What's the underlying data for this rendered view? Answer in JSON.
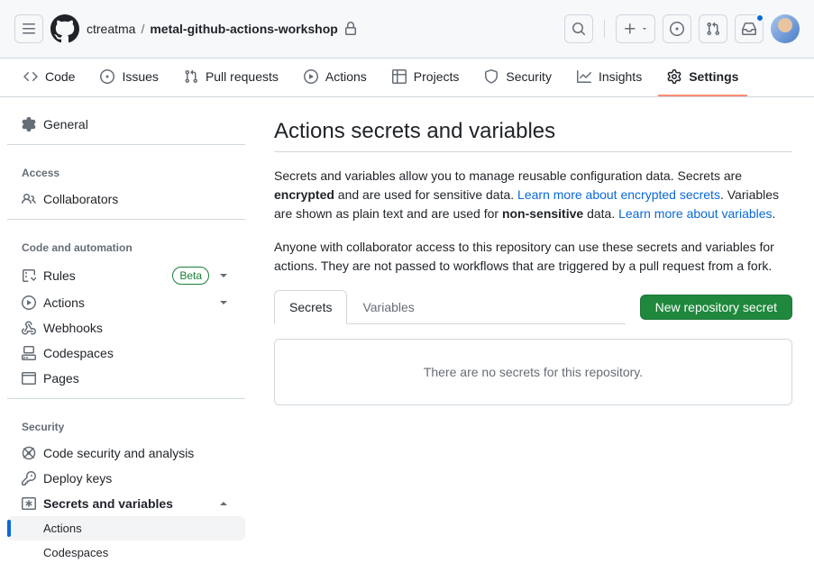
{
  "header": {
    "owner": "ctreatma",
    "repo": "metal-github-actions-workshop"
  },
  "repoNav": [
    {
      "label": "Code",
      "icon": "code-icon"
    },
    {
      "label": "Issues",
      "icon": "issue-icon"
    },
    {
      "label": "Pull requests",
      "icon": "pr-icon"
    },
    {
      "label": "Actions",
      "icon": "play-icon"
    },
    {
      "label": "Projects",
      "icon": "table-icon"
    },
    {
      "label": "Security",
      "icon": "shield-icon"
    },
    {
      "label": "Insights",
      "icon": "graph-icon"
    },
    {
      "label": "Settings",
      "icon": "gear-icon",
      "active": true
    }
  ],
  "sidebar": {
    "general": "General",
    "groups": [
      {
        "heading": "Access",
        "items": [
          {
            "label": "Collaborators",
            "icon": "people-icon"
          }
        ]
      },
      {
        "heading": "Code and automation",
        "items": [
          {
            "label": "Rules",
            "icon": "rules-icon",
            "badge": "Beta",
            "expandable": true
          },
          {
            "label": "Actions",
            "icon": "play-icon",
            "expandable": true
          },
          {
            "label": "Webhooks",
            "icon": "webhook-icon"
          },
          {
            "label": "Codespaces",
            "icon": "codespaces-icon"
          },
          {
            "label": "Pages",
            "icon": "browser-icon"
          }
        ]
      },
      {
        "heading": "Security",
        "items": [
          {
            "label": "Code security and analysis",
            "icon": "scan-icon"
          },
          {
            "label": "Deploy keys",
            "icon": "key-icon"
          },
          {
            "label": "Secrets and variables",
            "icon": "secret-icon",
            "bold": true,
            "expanded": true,
            "subs": [
              {
                "label": "Actions",
                "active": true
              },
              {
                "label": "Codespaces"
              }
            ]
          }
        ]
      }
    ]
  },
  "page": {
    "title": "Actions secrets and variables",
    "intro1_a": "Secrets and variables allow you to manage reusable configuration data. Secrets are ",
    "intro1_b": "encrypted",
    "intro1_c": " and are used for sensitive data. ",
    "intro1_link1": "Learn more about encrypted secrets",
    "intro1_d": ". Variables are shown as plain text and are used for ",
    "intro1_e": "non-sensitive",
    "intro1_f": " data. ",
    "intro1_link2": "Learn more about variables",
    "intro1_g": ".",
    "intro2": "Anyone with collaborator access to this repository can use these secrets and variables for actions. They are not passed to workflows that are triggered by a pull request from a fork.",
    "tabs": {
      "secrets": "Secrets",
      "variables": "Variables"
    },
    "newButton": "New repository secret",
    "empty": "There are no secrets for this repository."
  }
}
